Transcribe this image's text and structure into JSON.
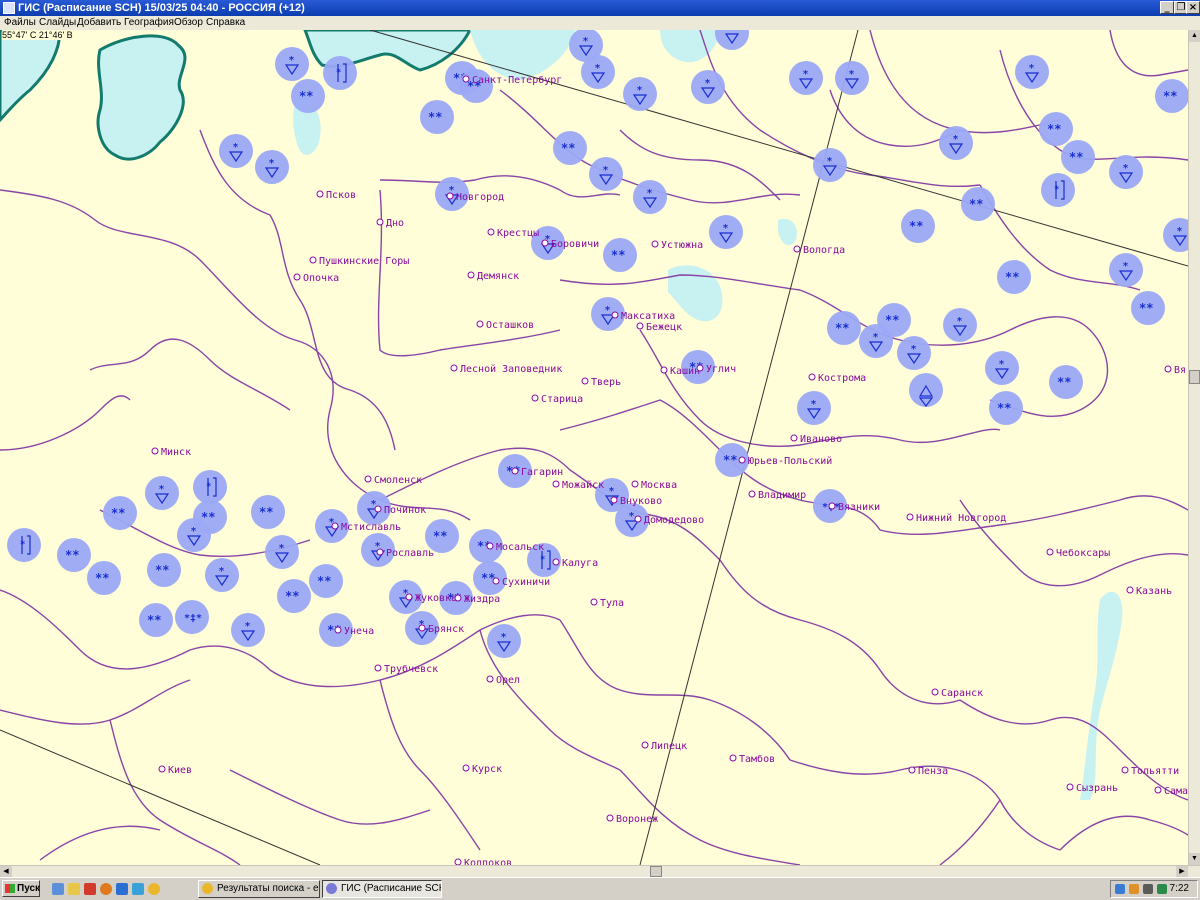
{
  "window": {
    "title": "ГИС (Расписание SCH) 15/03/25 04:40 - РОССИЯ (+12)",
    "minimize_glyph": "_",
    "restore_glyph": "❐",
    "close_glyph": "×"
  },
  "menu": [
    "Файлы",
    "Слайды",
    "Добавить",
    "География",
    "Обзор",
    "Справка"
  ],
  "coordinates": "55°47' С 21°46' В",
  "colors": {
    "land": "#fffed8",
    "water": "#c8f2f2",
    "coast": "#137a6e",
    "border": "#8a43a6",
    "city": "#8a0aa0",
    "station_fill": "#9ba9f5",
    "symbol": "#1a2fd0"
  },
  "cities": [
    {
      "name": "Санкт-Петербург"
    },
    {
      "name": "Псков"
    },
    {
      "name": "Дно"
    },
    {
      "name": "Новгород"
    },
    {
      "name": "Крестцы"
    },
    {
      "name": "Боровичи"
    },
    {
      "name": "Устюжна"
    },
    {
      "name": "Вологда"
    },
    {
      "name": "Пушкинские Горы"
    },
    {
      "name": "Опочка"
    },
    {
      "name": "Демянск"
    },
    {
      "name": "Осташков"
    },
    {
      "name": "Максатиха"
    },
    {
      "name": "Бежецк"
    },
    {
      "name": "Лесной Заповедник"
    },
    {
      "name": "Тверь"
    },
    {
      "name": "Старица"
    },
    {
      "name": "Кашин"
    },
    {
      "name": "Углич"
    },
    {
      "name": "Кострома"
    },
    {
      "name": "Иваново"
    },
    {
      "name": "Минск"
    },
    {
      "name": "Смоленск"
    },
    {
      "name": "Гагарин"
    },
    {
      "name": "Можайск"
    },
    {
      "name": "Москва"
    },
    {
      "name": "Внуково"
    },
    {
      "name": "Домодедово"
    },
    {
      "name": "Юрьев-Польский"
    },
    {
      "name": "Владимир"
    },
    {
      "name": "Вязники"
    },
    {
      "name": "Нижний Новгород"
    },
    {
      "name": "Починок"
    },
    {
      "name": "Мстиславль"
    },
    {
      "name": "Рославль"
    },
    {
      "name": "Мосальск"
    },
    {
      "name": "Калуга"
    },
    {
      "name": "Сухиничи"
    },
    {
      "name": "Жуковка"
    },
    {
      "name": "Жиздра"
    },
    {
      "name": "Брянск"
    },
    {
      "name": "Унеча"
    },
    {
      "name": "Тула"
    },
    {
      "name": "Трубчевск"
    },
    {
      "name": "Орел"
    },
    {
      "name": "Чебоксары"
    },
    {
      "name": "Казань"
    },
    {
      "name": "Саранск"
    },
    {
      "name": "Липецк"
    },
    {
      "name": "Тамбов"
    },
    {
      "name": "Пенза"
    },
    {
      "name": "Киев"
    },
    {
      "name": "Курск"
    },
    {
      "name": "Воронеж"
    },
    {
      "name": "Колпоков"
    },
    {
      "name": "Сызрань"
    },
    {
      "name": "Тольятти"
    },
    {
      "name": "Сама"
    },
    {
      "name": "Вя"
    }
  ],
  "station_symbols": [
    "snow-shower",
    "snow-shower",
    "snow-shower",
    "snow-shower",
    "snow-shower",
    "thunder-snow",
    "snow-shower",
    "snow-shower",
    "snow",
    "snow",
    "snow",
    "snow",
    "snow-shower",
    "snow-shower",
    "snow",
    "snow",
    "snow-shower",
    "snow-shower",
    "snow",
    "snow-shower",
    "snow-shower",
    "snow",
    "snow-shower",
    "snow-shower",
    "snow-shower",
    "snow-shower",
    "snow",
    "thunder-snow",
    "snow",
    "snow-shower",
    "snow-shower",
    "snow-shower",
    "snow",
    "snow",
    "snow-shower",
    "snow",
    "snow-shower",
    "snow",
    "snow",
    "snow-shower",
    "snow-shower",
    "snow-shower",
    "snow",
    "snow-shower",
    "snow",
    "hail-shower",
    "snow-shower",
    "snow",
    "snow",
    "snow",
    "snow-shower",
    "thunder-snow",
    "snow-shower",
    "snow",
    "blowing-snow",
    "snow-shower",
    "snow",
    "snow-shower",
    "snow",
    "snow-shower",
    "snow-shower",
    "thunder-snow",
    "snow",
    "snow",
    "snow",
    "snow-shower",
    "snow",
    "snow-shower",
    "snow-shower",
    "thunder-snow",
    "snow",
    "snow",
    "snow",
    "snow",
    "snow-shower",
    "snow",
    "snow",
    "blowing-snow",
    "snow-shower",
    "snow",
    "snow-shower",
    "snow-shower",
    "snow-shower",
    "snow",
    "snow-shower",
    "snow",
    "snow-shower",
    "snow-shower",
    "thunder-snow",
    "snow",
    "snow-shower",
    "snow",
    "snow-shower",
    "snow",
    "snow-shower"
  ],
  "taskbar": {
    "start_label": "Пуск",
    "tasks": [
      "Результаты поиска - е...",
      "ГИС (Расписание SCH..."
    ],
    "clock": "7:22"
  }
}
